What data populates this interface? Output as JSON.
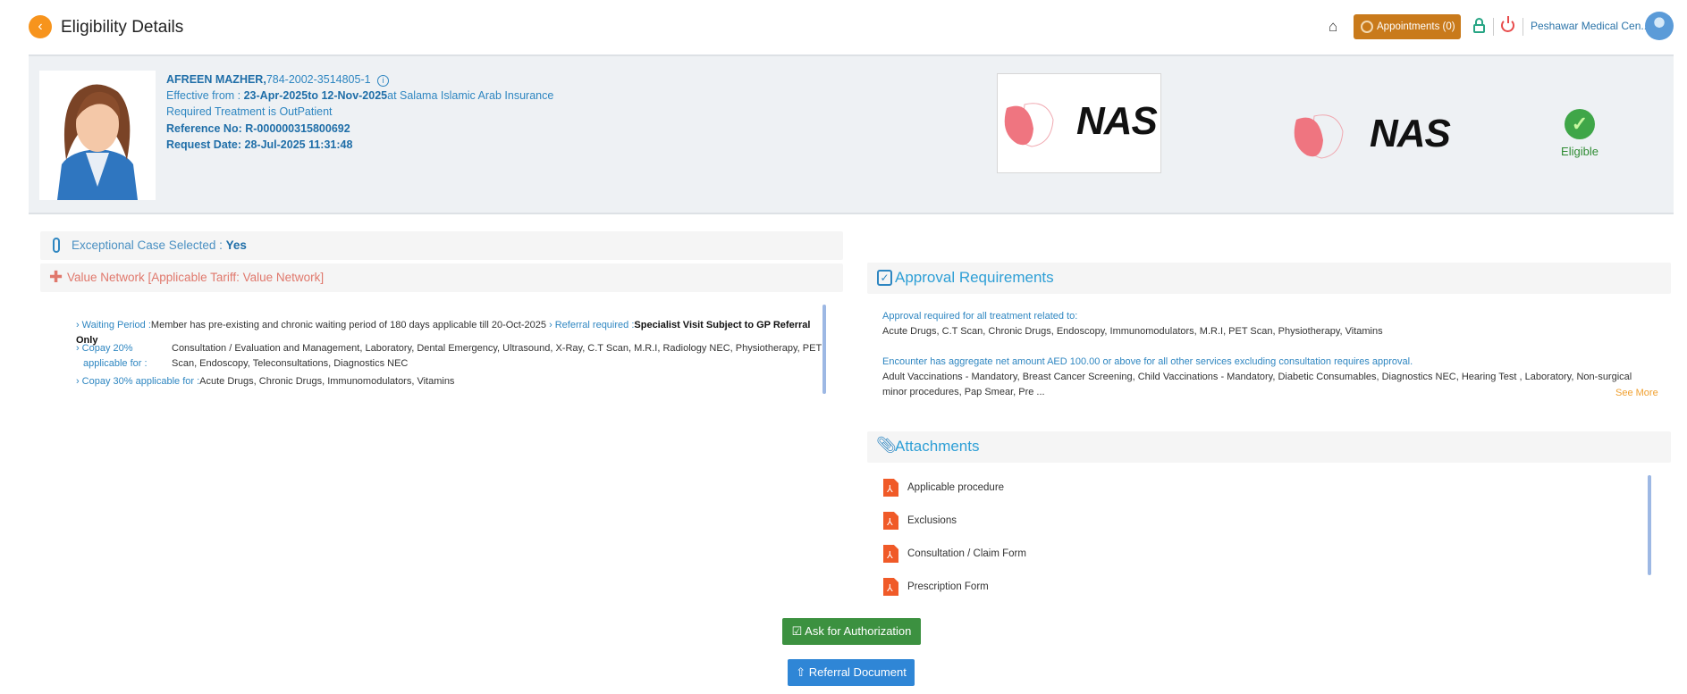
{
  "header": {
    "title": "Eligibility Details",
    "appointments_label": "Appointments (0)",
    "clinic": "Peshawar Medical Cen..."
  },
  "patient": {
    "name": "AFREEN MAZHER,",
    "id": "784-2002-3514805-1",
    "effective_prefix": "Effective from : ",
    "effective_from": "23-Apr-2025",
    "to_word": "to ",
    "effective_to": "12-Nov-2025",
    "at_insurer": "at Salama Islamic Arab Insurance",
    "treatment": "Required Treatment is OutPatient",
    "reference": "Reference No: R-000000315800692",
    "request_date": "Request Date: 28-Jul-2025 11:31:48"
  },
  "payer_logo": "NAS",
  "tpa_logo": "NAS",
  "status": {
    "label": "Eligible",
    "color": "#3fa648"
  },
  "exceptional": {
    "label": "Exceptional Case Selected : ",
    "value": "Yes"
  },
  "network": {
    "title": "Value Network [Applicable Tariff: Value Network]"
  },
  "benefits": {
    "waiting_label": "Waiting Period :",
    "waiting_text": "Member has pre-existing and chronic waiting period of 180 days applicable till 20-Oct-2025",
    "referral_label": "Referral required :",
    "referral_text": "Specialist Visit Subject to GP Referral Only",
    "copay20_label1": "Copay 20%",
    "copay20_label2": "applicable for :",
    "copay20_text": "Consultation / Evaluation and Management, Laboratory, Dental Emergency, Ultrasound, X-Ray, C.T Scan, M.R.I, Radiology NEC, Physiotherapy, PET Scan, Endoscopy, Teleconsultations, Diagnostics NEC",
    "copay30_label": "Copay 30% applicable for :",
    "copay30_text": "Acute Drugs, Chronic Drugs, Immunomodulators, Vitamins"
  },
  "approval": {
    "title": "Approval Requirements",
    "rule1_title": "Approval required for all treatment related to:",
    "rule1_text": "Acute Drugs, C.T Scan, Chronic Drugs, Endoscopy, Immunomodulators, M.R.I, PET Scan, Physiotherapy, Vitamins",
    "rule2_title": "Encounter has aggregate net amount AED 100.00 or above for all other services excluding consultation requires approval.",
    "rule2_text": "Adult Vaccinations - Mandatory, Breast Cancer Screening, Child Vaccinations - Mandatory, Diabetic Consumables, Diagnostics NEC, Hearing Test , Laboratory, Non-surgical minor procedures, Pap Smear, Pre ...",
    "see_more": "See More"
  },
  "attachments": {
    "title": "Attachments",
    "items": [
      "Applicable procedure",
      "Exclusions",
      "Consultation / Claim Form",
      "Prescription Form"
    ]
  },
  "actions": {
    "authorize": "Ask for Authorization",
    "referral": "Referral Document"
  }
}
